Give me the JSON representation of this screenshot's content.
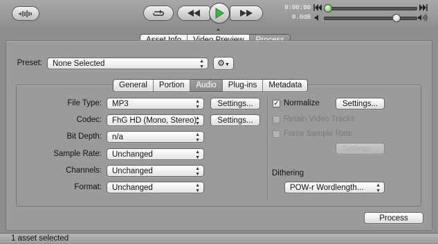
{
  "toolbar": {
    "icons": {
      "waveform": "waveform-icon",
      "loop": "loop-icon",
      "rewind": "rewind-icon",
      "play": "play-icon",
      "fast_forward": "fast-forward-icon",
      "skip_back": "skip-back-icon",
      "skip_forward": "skip-forward-icon",
      "volume_low": "volume-low-icon",
      "volume_high": "volume-high-icon"
    },
    "time": "0:00:00",
    "gain": "0.0dB",
    "play_color": "#3ab83a"
  },
  "main_tabs": [
    "Asset Info",
    "Video Preview",
    "Process"
  ],
  "main_tab_active": "Process",
  "preset": {
    "label": "Preset:",
    "value": "None Selected",
    "action_icon": "gear-icon"
  },
  "sub_tabs": [
    "General",
    "Portion",
    "Audio",
    "Plug-ins",
    "Metadata"
  ],
  "sub_tab_active": "Audio",
  "audio": {
    "file_type": {
      "label": "File Type:",
      "value": "MP3",
      "settings": "Settings..."
    },
    "codec": {
      "label": "Codec:",
      "value": "FhG HD (Mono, Stereo)",
      "settings": "Settings..."
    },
    "bit_depth": {
      "label": "Bit Depth:",
      "value": "n/a"
    },
    "sample_rate": {
      "label": "Sample Rate:",
      "value": "Unchanged"
    },
    "channels": {
      "label": "Channels:",
      "value": "Unchanged"
    },
    "format": {
      "label": "Format:",
      "value": "Unchanged"
    }
  },
  "right": {
    "normalize": {
      "label": "Normalize",
      "checked": true,
      "settings": "Settings..."
    },
    "retain_video": {
      "label": "Retain Video Tracks",
      "checked": false
    },
    "force_sample_rate": {
      "label": "Force Sample Rate",
      "checked": false
    },
    "force_settings": "Settings...",
    "dithering_label": "Dithering",
    "dithering_value": "POW-r Wordlength..."
  },
  "process_button": "Process",
  "status": "1 asset selected"
}
